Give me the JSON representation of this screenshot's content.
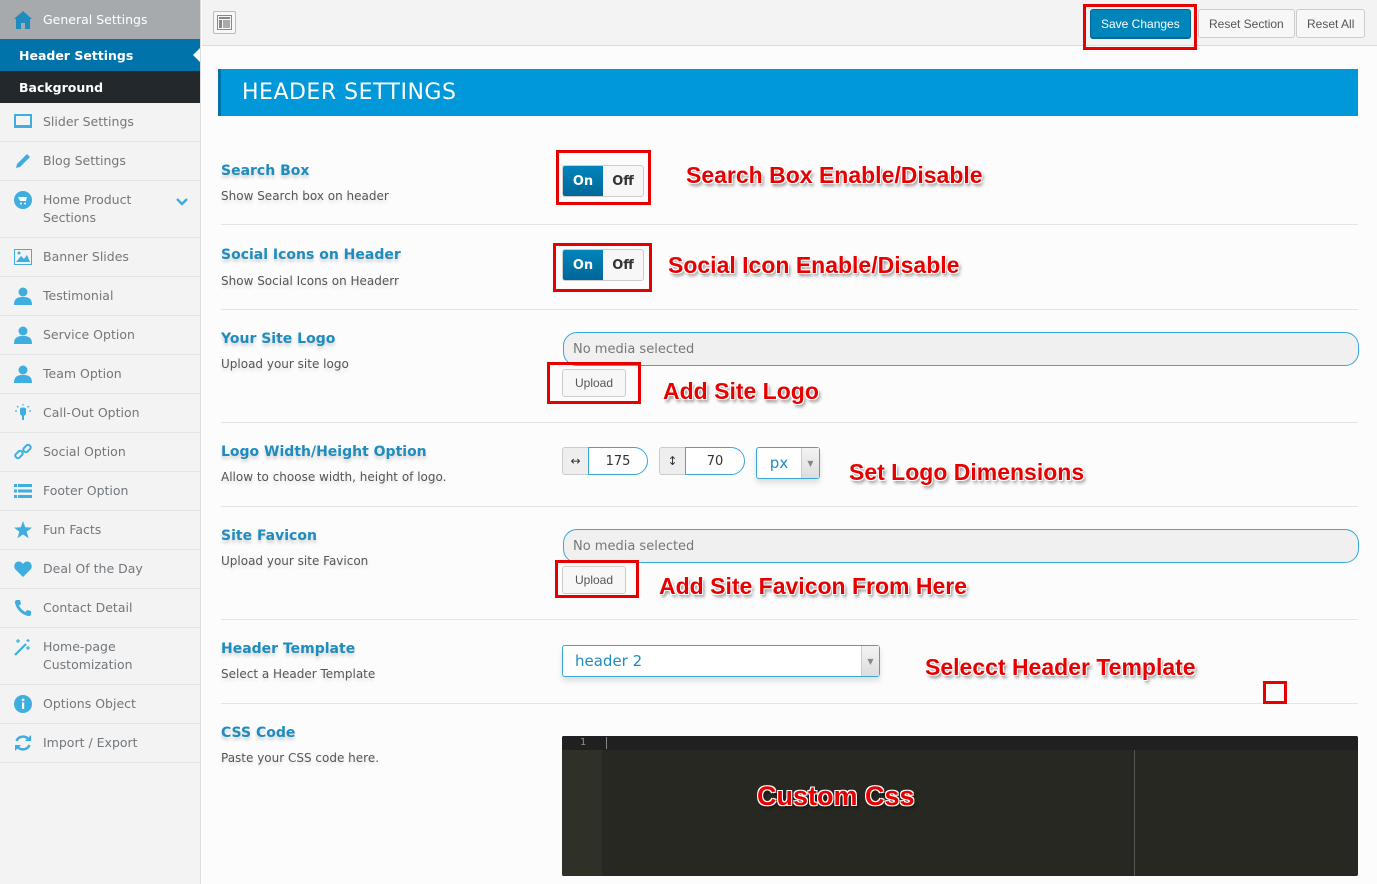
{
  "sidebar": {
    "general": {
      "label": "General Settings",
      "icon": "home-icon"
    },
    "subitems": [
      {
        "label": "Header Settings",
        "active": true
      },
      {
        "label": "Background",
        "active": false
      }
    ],
    "items": [
      {
        "label": "Slider Settings",
        "icon": "monitor-icon"
      },
      {
        "label": "Blog Settings",
        "icon": "pencil-icon"
      },
      {
        "label": "Home Product Sections",
        "icon": "cart-icon",
        "expandable": true
      },
      {
        "label": "Banner Slides",
        "icon": "image-icon"
      },
      {
        "label": "Testimonial",
        "icon": "user-icon"
      },
      {
        "label": "Service Option",
        "icon": "user-icon"
      },
      {
        "label": "Team Option",
        "icon": "user-icon"
      },
      {
        "label": "Call-Out Option",
        "icon": "lightbulb-icon"
      },
      {
        "label": "Social Option",
        "icon": "link-icon"
      },
      {
        "label": "Footer Option",
        "icon": "list-icon"
      },
      {
        "label": "Fun Facts",
        "icon": "star-icon"
      },
      {
        "label": "Deal Of the Day",
        "icon": "heart-icon"
      },
      {
        "label": "Contact Detail",
        "icon": "phone-icon"
      },
      {
        "label": "Home-page Customization",
        "icon": "magic-wand-icon"
      },
      {
        "label": "Options Object",
        "icon": "info-icon"
      },
      {
        "label": "Import / Export",
        "icon": "refresh-icon"
      }
    ]
  },
  "toolbar": {
    "save_label": "Save Changes",
    "reset_section_label": "Reset Section",
    "reset_all_label": "Reset All"
  },
  "section": {
    "title": "HEADER SETTINGS"
  },
  "fields": {
    "search_box": {
      "title": "Search Box",
      "desc": "Show Search box on header",
      "on": "On",
      "off": "Off",
      "value": "On"
    },
    "social_icons": {
      "title": "Social Icons on Header",
      "desc": "Show Social Icons on Headerr",
      "on": "On",
      "off": "Off",
      "value": "On"
    },
    "site_logo": {
      "title": "Your Site Logo",
      "desc": "Upload your site logo",
      "placeholder": "No media selected",
      "upload_label": "Upload"
    },
    "logo_dims": {
      "title": "Logo Width/Height Option",
      "desc": "Allow to choose width, height of logo.",
      "width": "175",
      "height": "70",
      "unit": "px",
      "width_icon": "↔",
      "height_icon": "↕"
    },
    "favicon": {
      "title": "Site Favicon",
      "desc": "Upload your site Favicon",
      "placeholder": "No media selected",
      "upload_label": "Upload"
    },
    "header_template": {
      "title": "Header Template",
      "desc": "Select a Header Template",
      "value": "header 2"
    },
    "css_code": {
      "title": "CSS Code",
      "desc": "Paste your CSS code here.",
      "line_number": "1"
    }
  },
  "annotations": {
    "search_box": "Search Box Enable/Disable",
    "social_icons": "Social Icon Enable/Disable",
    "site_logo": "Add Site Logo",
    "logo_dims": "Set Logo Dimensions",
    "favicon": "Add Site Favicon From Here",
    "header_template": "Selecct Header Template",
    "css": "Custom Css"
  },
  "colors": {
    "accent": "#0073aa",
    "banner": "#0098d8",
    "annotation": "#e60000",
    "icon": "#3eaee0"
  }
}
